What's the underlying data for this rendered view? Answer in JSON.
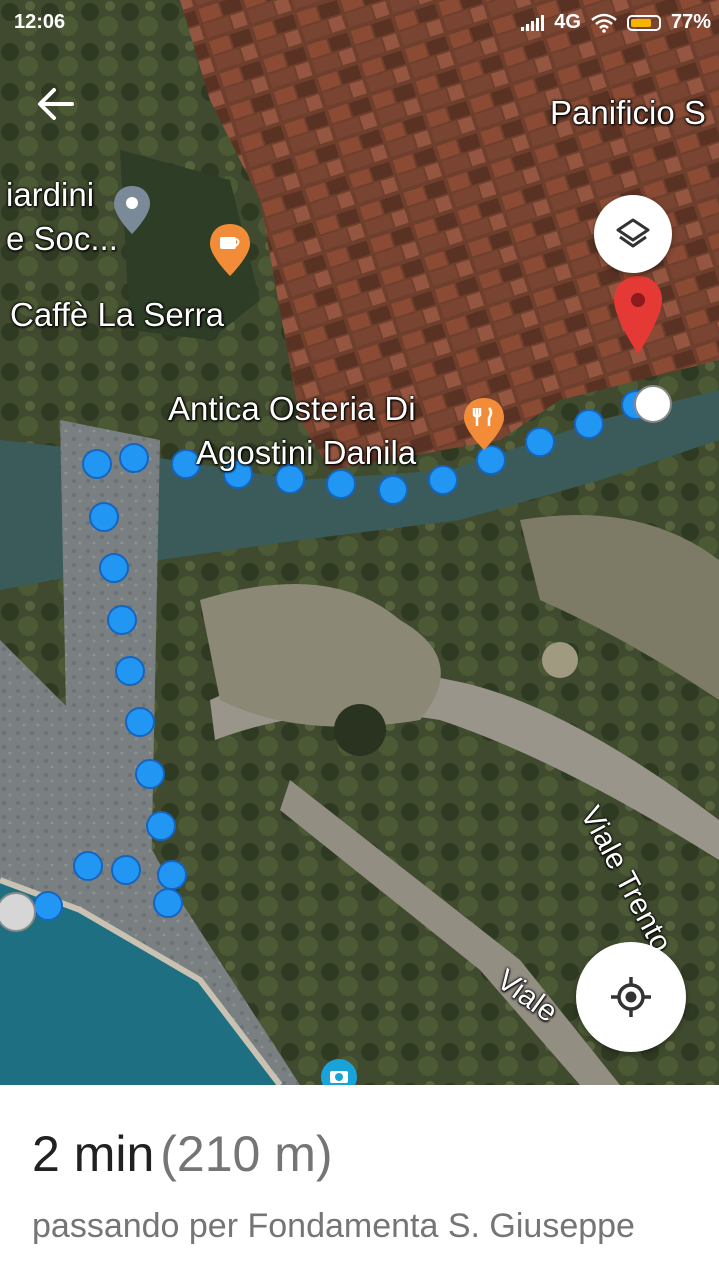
{
  "status_bar": {
    "time": "12:06",
    "network": "4G",
    "battery": "77%",
    "icons": [
      "signal-icon",
      "wifi-icon",
      "battery-icon"
    ]
  },
  "map": {
    "labels": {
      "panificio": "Panificio S",
      "giardini_line1": "iardini",
      "giardini_line2": "e Soc...",
      "caffe": "Caffè La Serra",
      "antica_line1": "Antica Osteria Di",
      "antica_line2": "Agostini Danila",
      "viale_trento": "Viale Trento",
      "viale_bottom": "Viale"
    },
    "icons": [
      "back-arrow-icon",
      "layers-icon",
      "my-location-icon",
      "destination-pin-icon",
      "cafe-icon",
      "restaurant-icon",
      "place-pin-icon",
      "camera-icon"
    ],
    "colors": {
      "route": "#2196f3",
      "destination_pin": "#e53935",
      "poi": "#f28c38"
    }
  },
  "route_info": {
    "duration": "2 min",
    "distance": "(210 m)",
    "via": "passando per Fondamenta S. Giuseppe"
  }
}
